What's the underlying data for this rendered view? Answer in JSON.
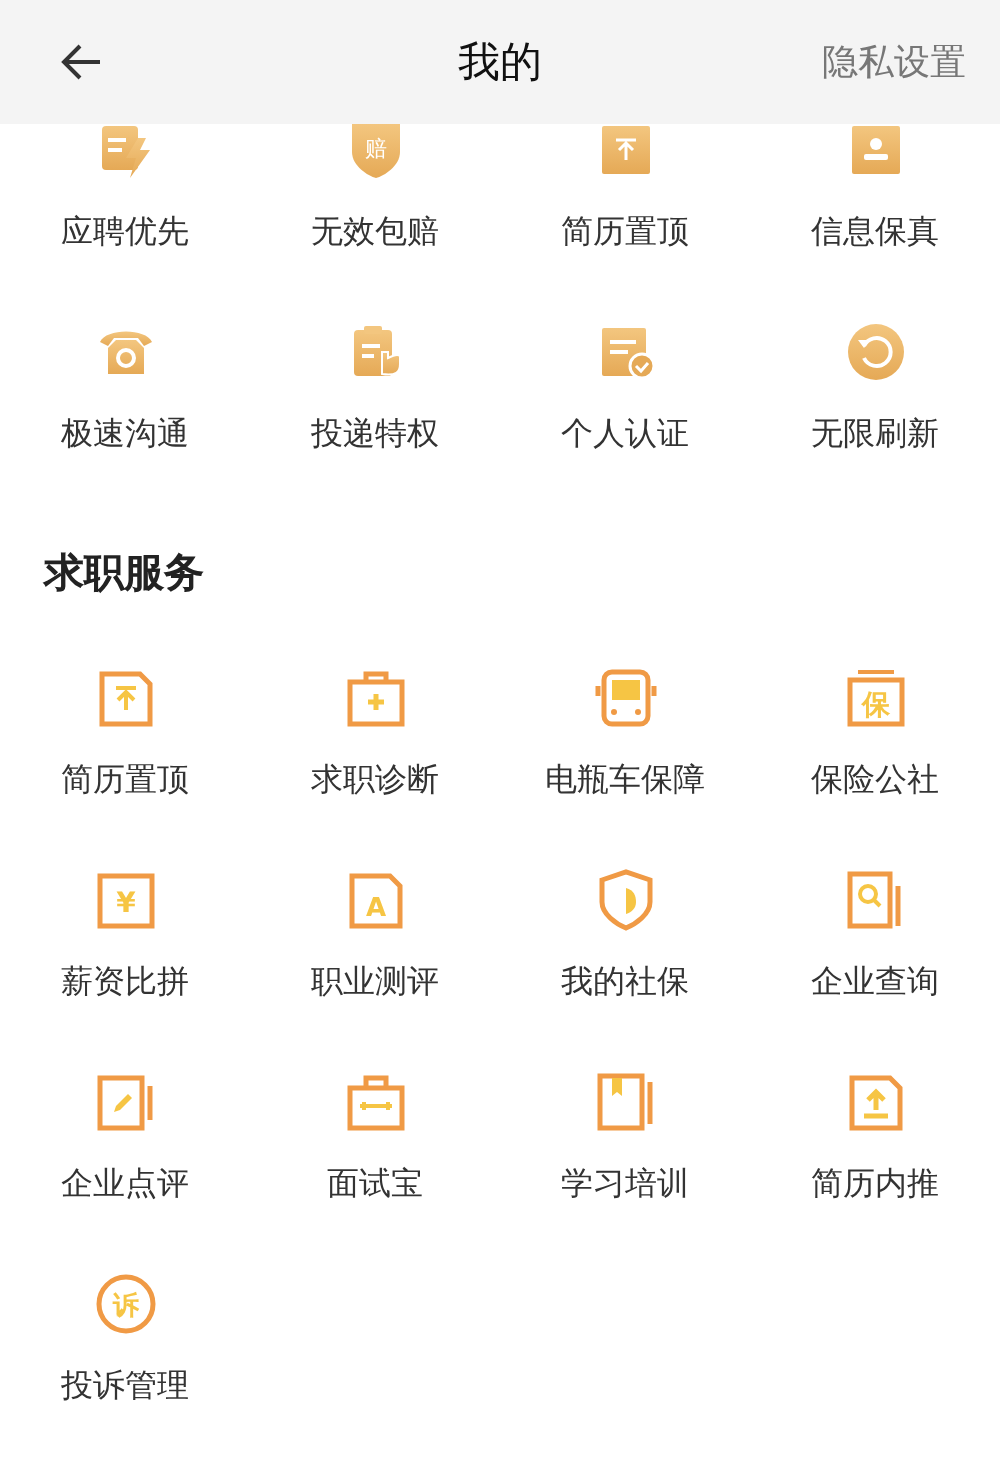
{
  "header": {
    "title": "我的",
    "action": "隐私设置"
  },
  "privileges": [
    {
      "label": "应聘优先",
      "kind": "bolt"
    },
    {
      "label": "无效包赔",
      "kind": "shield",
      "glyph": "赔"
    },
    {
      "label": "简历置顶",
      "kind": "top"
    },
    {
      "label": "信息保真",
      "kind": "badge"
    },
    {
      "label": "极速沟通",
      "kind": "phone"
    },
    {
      "label": "投递特权",
      "kind": "clipboard"
    },
    {
      "label": "个人认证",
      "kind": "check"
    },
    {
      "label": "无限刷新",
      "kind": "refresh"
    }
  ],
  "services": {
    "title": "求职服务",
    "items": [
      {
        "label": "简历置顶",
        "kind": "top"
      },
      {
        "label": "求职诊断",
        "kind": "medkit"
      },
      {
        "label": "电瓶车保障",
        "kind": "bus"
      },
      {
        "label": "保险公社",
        "kind": "insurance",
        "glyph": "保"
      },
      {
        "label": "薪资比拼",
        "kind": "salary",
        "glyph": "¥"
      },
      {
        "label": "职业测评",
        "kind": "test",
        "glyph": "A"
      },
      {
        "label": "我的社保",
        "kind": "shield"
      },
      {
        "label": "企业查询",
        "kind": "search"
      },
      {
        "label": "企业点评",
        "kind": "review"
      },
      {
        "label": "面试宝",
        "kind": "briefcase"
      },
      {
        "label": "学习培训",
        "kind": "book"
      },
      {
        "label": "简历内推",
        "kind": "upload"
      },
      {
        "label": "投诉管理",
        "kind": "complaint",
        "glyph": "诉"
      }
    ]
  }
}
